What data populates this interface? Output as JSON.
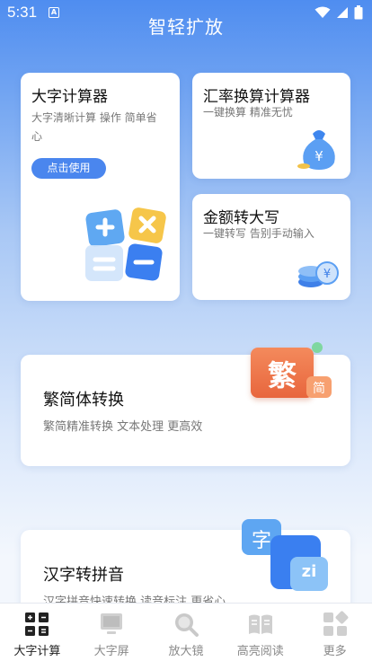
{
  "status_bar": {
    "time": "5:31",
    "notify_glyph": "A"
  },
  "app": {
    "title": "智轻扩放"
  },
  "cards": {
    "calculator": {
      "title": "大字计算器",
      "subtitle": "大字清晰计算 操作 简单省心",
      "button": "点击使用"
    },
    "exchange": {
      "title": "汇率换算计算器",
      "subtitle": "一键换算 精准无忧"
    },
    "amount": {
      "title": "金额转大写",
      "subtitle": "一键转写 告别手动输入"
    },
    "traditional": {
      "title": "繁简体转换",
      "subtitle": "繁简精准转换 文本处理 更高效",
      "badge_main": "繁",
      "badge_small": "简"
    },
    "pinyin": {
      "title": "汉字转拼音",
      "subtitle": "汉字拼音快速转换 读音标注 更省心",
      "bubble_char": "字",
      "bubble_pinyin": "zi"
    }
  },
  "nav": {
    "items": [
      {
        "label": "大字计算",
        "icon": "calculator-grid-icon",
        "active": true
      },
      {
        "label": "大字屏",
        "icon": "monitor-icon",
        "active": false
      },
      {
        "label": "放大镜",
        "icon": "magnifier-icon",
        "active": false
      },
      {
        "label": "高亮阅读",
        "icon": "book-icon",
        "active": false
      },
      {
        "label": "更多",
        "icon": "more-grid-icon",
        "active": false
      }
    ]
  },
  "colors": {
    "accent": "#4a86ee",
    "header": "#4f8df0"
  }
}
